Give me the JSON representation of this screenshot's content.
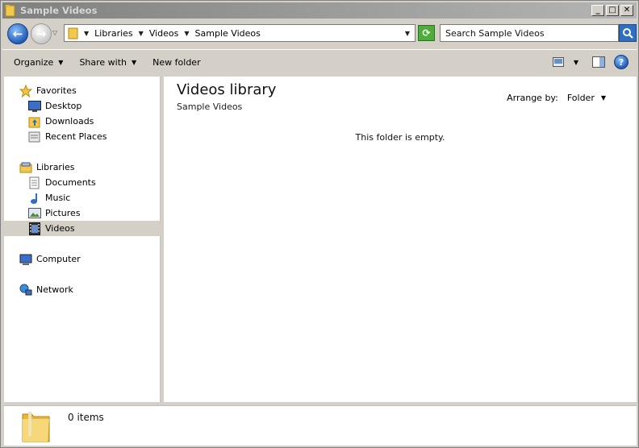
{
  "window": {
    "title": "Sample Videos",
    "controls": {
      "minimize": "_",
      "maximize": "□",
      "close": "✕"
    }
  },
  "address_bar": {
    "breadcrumbs": [
      "Libraries",
      "Videos",
      "Sample Videos"
    ],
    "search_placeholder": "Search Sample Videos"
  },
  "toolbar": {
    "organize_label": "Organize",
    "share_label": "Share with",
    "new_folder_label": "New folder"
  },
  "nav_pane": {
    "favorites": {
      "label": "Favorites",
      "items": [
        {
          "label": "Desktop",
          "icon": "desktop-icon"
        },
        {
          "label": "Downloads",
          "icon": "downloads-icon"
        },
        {
          "label": "Recent Places",
          "icon": "recent-places-icon"
        }
      ]
    },
    "libraries": {
      "label": "Libraries",
      "items": [
        {
          "label": "Documents",
          "icon": "documents-icon"
        },
        {
          "label": "Music",
          "icon": "music-icon"
        },
        {
          "label": "Pictures",
          "icon": "pictures-icon"
        },
        {
          "label": "Videos",
          "icon": "videos-icon",
          "selected": true
        }
      ]
    },
    "computer": {
      "label": "Computer"
    },
    "network": {
      "label": "Network"
    }
  },
  "content": {
    "title": "Videos library",
    "subtitle": "Sample Videos",
    "arrange_label": "Arrange by:",
    "arrange_value": "Folder",
    "empty_message": "This folder is empty."
  },
  "details": {
    "item_count": "0 items"
  },
  "colors": {
    "chrome": "#d4d0c8",
    "selection": "#d4d0c8",
    "folder": "#f2c94c",
    "accent_blue": "#1f5db8"
  }
}
